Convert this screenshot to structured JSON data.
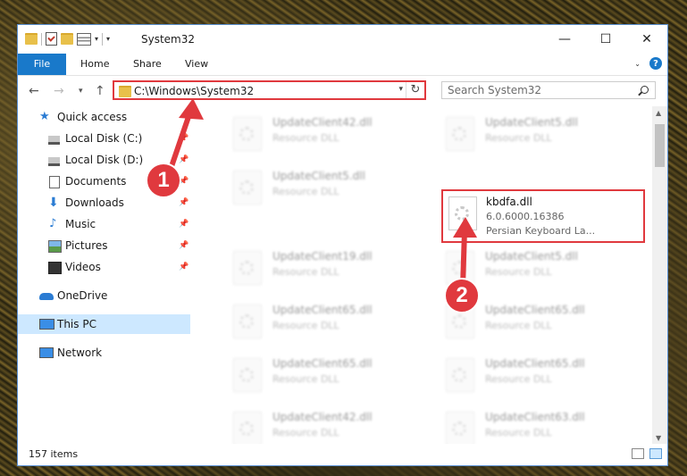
{
  "window": {
    "title": "System32"
  },
  "ribbon": {
    "tabs": [
      "File",
      "Home",
      "Share",
      "View"
    ]
  },
  "address": {
    "path": "C:\\Windows\\System32"
  },
  "search": {
    "placeholder": "Search System32"
  },
  "nav": {
    "quick_access": "Quick access",
    "items": [
      {
        "label": "Local Disk (C:)",
        "icon": "drive-icon"
      },
      {
        "label": "Local Disk (D:)",
        "icon": "drive-icon"
      },
      {
        "label": "Documents",
        "icon": "documents-icon"
      },
      {
        "label": "Downloads",
        "icon": "downloads-icon"
      },
      {
        "label": "Music",
        "icon": "music-icon"
      },
      {
        "label": "Pictures",
        "icon": "pictures-icon"
      },
      {
        "label": "Videos",
        "icon": "videos-icon"
      }
    ],
    "onedrive": "OneDrive",
    "this_pc": "This PC",
    "network": "Network"
  },
  "files": [
    {
      "name": "UpdateClient42.dll",
      "desc": "Resource DLL"
    },
    {
      "name": "UpdateClient5.dll",
      "desc": "Resource DLL"
    },
    {
      "name": "UpdateClient5.dll",
      "desc": "Resource DLL"
    },
    {
      "name": "UpdateClient19.dll",
      "desc": "Resource DLL"
    },
    {
      "name": "UpdateClient5.dll",
      "desc": "Resource DLL"
    },
    {
      "name": "UpdateClient65.dll",
      "desc": "Resource DLL"
    },
    {
      "name": "UpdateClient65.dll",
      "desc": "Resource DLL"
    },
    {
      "name": "UpdateClient65.dll",
      "desc": "Resource DLL"
    },
    {
      "name": "UpdateClient65.dll",
      "desc": "Resource DLL"
    },
    {
      "name": "UpdateClient42.dll",
      "desc": "Resource DLL"
    },
    {
      "name": "UpdateClient63.dll",
      "desc": "Resource DLL"
    }
  ],
  "highlighted_file": {
    "name": "kbdfa.dll",
    "version": "6.0.6000.16386",
    "desc": "Persian Keyboard La..."
  },
  "status": {
    "count": "157 items"
  },
  "annotations": {
    "step1": "1",
    "step2": "2"
  },
  "colors": {
    "accent": "#1979ca",
    "highlight": "#e0393e",
    "selection": "#cde8ff"
  }
}
